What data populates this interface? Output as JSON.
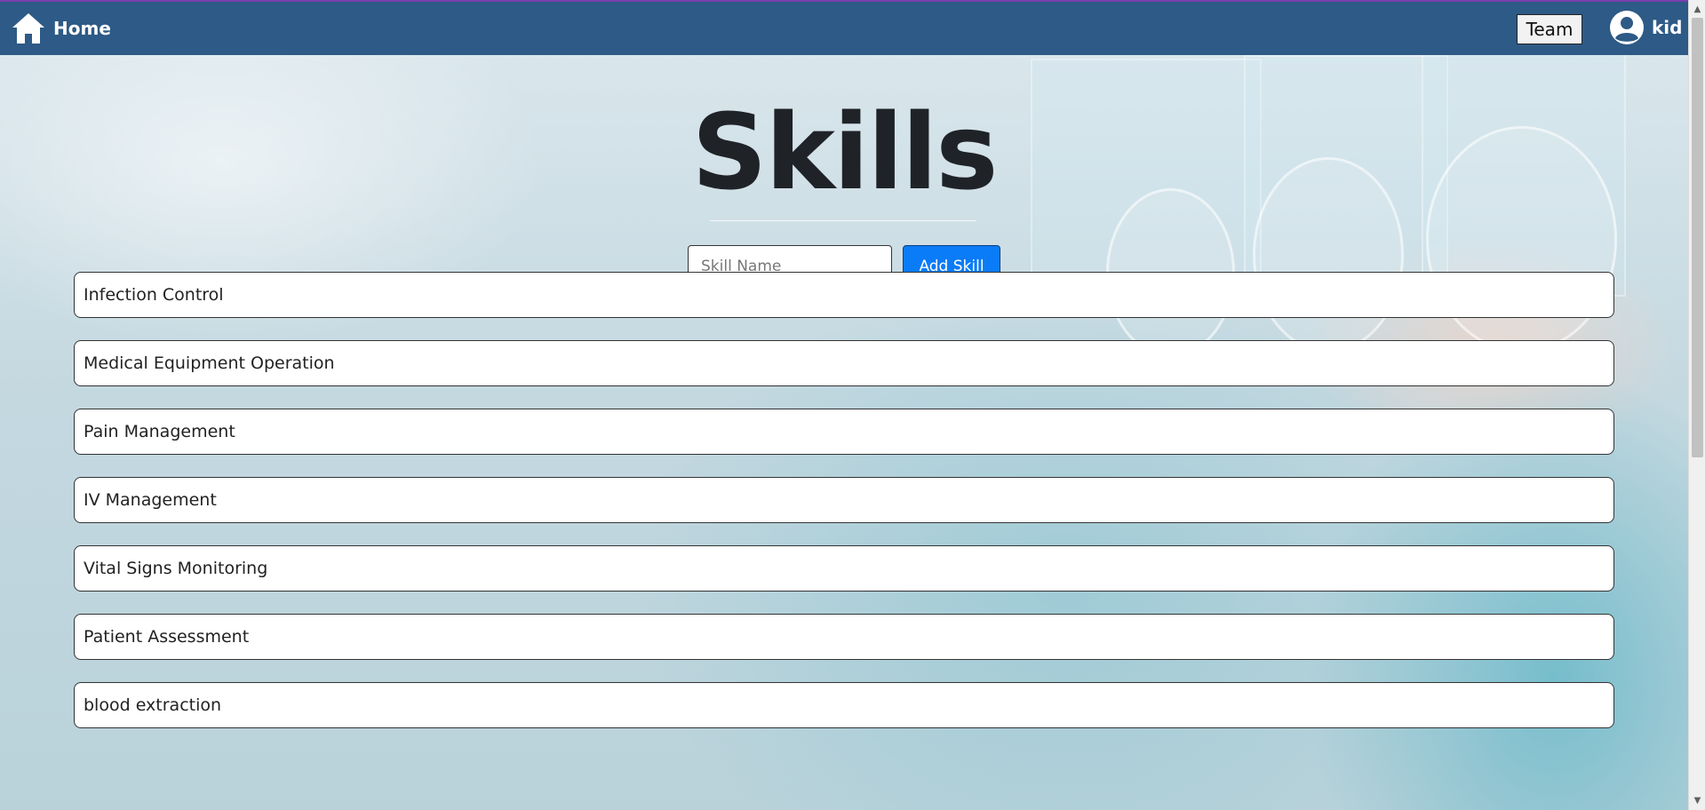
{
  "navbar": {
    "home_label": "Home",
    "team_label": "Team",
    "user_name": "kid",
    "background_color": "#2d5a86"
  },
  "main": {
    "title": "Skills",
    "skill_input": {
      "placeholder": "Skill Name",
      "value": ""
    },
    "add_button_label": "Add Skill",
    "add_button_color": "#0a7cf7"
  },
  "skills": [
    "Infection Control",
    "Medical Equipment Operation",
    "Pain Management",
    "IV Management",
    "Vital Signs Monitoring",
    "Patient Assessment",
    "blood extraction"
  ],
  "icons": {
    "home": "home-icon",
    "user": "user-circle-icon"
  }
}
